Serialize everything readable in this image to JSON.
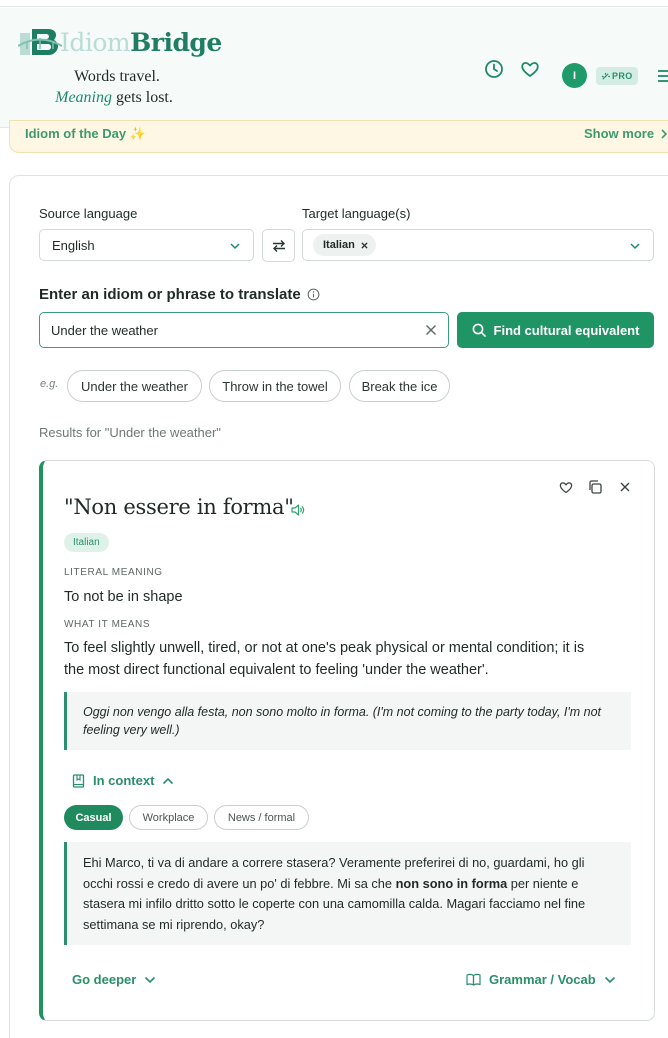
{
  "header": {
    "logo_part1": "Idiom",
    "logo_part2": "Bridge",
    "tagline_line1": "Words travel.",
    "tagline_em": "Meaning",
    "tagline_rest": " gets lost.",
    "avatar_initial": "I",
    "pro_label": "PRO"
  },
  "iotd": {
    "title": "Idiom of the Day ✨",
    "more": "Show more"
  },
  "form": {
    "source_label": "Source language",
    "source_value": "English",
    "target_label": "Target language(s)",
    "target_chip": "Italian",
    "prompt_label": "Enter an idiom or phrase to translate",
    "input_value": "Under the weather",
    "find_button": "Find cultural equivalent",
    "eg_label": "e.g.",
    "suggestions": [
      "Under the weather",
      "Throw in the towel",
      "Break the ice"
    ]
  },
  "results_for": "Results for \"Under the weather\"",
  "result": {
    "title": "\"Non essere in forma\"",
    "language": "Italian",
    "literal_heading": "LITERAL MEANING",
    "literal_text": "To not be in shape",
    "means_heading": "WHAT IT MEANS",
    "means_line1": "To feel slightly unwell, tired, or not at one's peak physical or mental condition; it is",
    "means_line2": "the most direct functional equivalent to feeling 'under the weather'.",
    "example": "Oggi non vengo alla festa, non sono molto in forma. (I'm not coming to the party today, I'm not feeling very well.)",
    "in_context_label": "In context",
    "tabs": [
      "Casual",
      "Workplace",
      "News / formal"
    ],
    "dialogue_before": "Ehi Marco, ti va di andare a correre stasera? Veramente preferirei di no, guardami, ho gli occhi rossi e credo di avere un po' di febbre. Mi sa che ",
    "dialogue_bold": "non sono in forma",
    "dialogue_after": " per niente e stasera mi infilo dritto sotto le coperte con una camomilla calda. Magari facciamo nel fine settimana se mi riprendo, okay?",
    "go_deeper": "Go deeper",
    "grammar": "Grammar / Vocab"
  },
  "colors": {
    "brand": "#1f9566",
    "accent_light": "#dff2ea",
    "banner": "#fdf7e3"
  }
}
